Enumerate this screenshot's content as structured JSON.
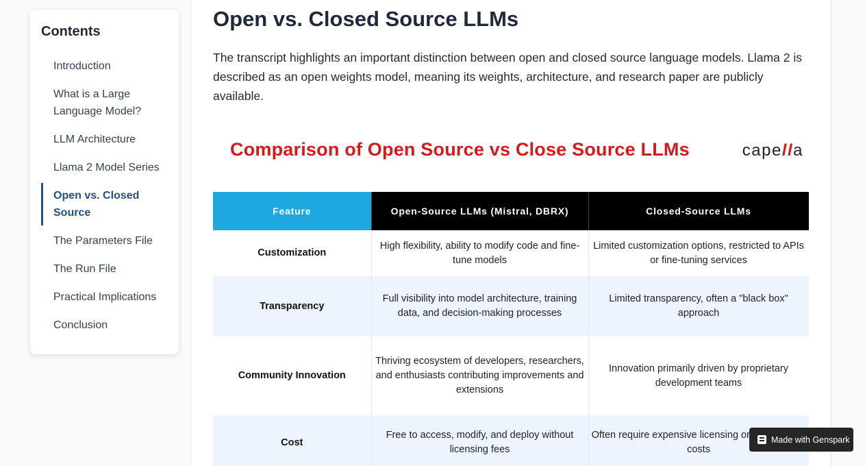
{
  "sidebar": {
    "title": "Contents",
    "items": [
      {
        "label": "Introduction"
      },
      {
        "label": "What is a Large Language Model?"
      },
      {
        "label": "LLM Architecture"
      },
      {
        "label": "Llama 2 Model Series"
      },
      {
        "label": "Open vs. Closed Source",
        "active": true
      },
      {
        "label": "The Parameters File"
      },
      {
        "label": "The Run File"
      },
      {
        "label": "Practical Implications"
      },
      {
        "label": "Conclusion"
      }
    ]
  },
  "main": {
    "heading": "Open vs. Closed Source LLMs",
    "intro": "The transcript highlights an important distinction between open and closed source language models. Llama 2 is described as an open weights model, meaning its weights, architecture, and research paper are publicly available."
  },
  "figure": {
    "title": "Comparison of Open Source vs Close Source LLMs",
    "logo": {
      "prefix": "cape",
      "highlight": "ll",
      "suffix": "a"
    },
    "headers": [
      "Feature",
      "Open-Source LLMs (Mistral, DBRX)",
      "Closed-Source LLMs"
    ],
    "rows": [
      {
        "feature": "Customization",
        "open": "High flexibility, ability to modify code and fine-tune models",
        "closed": "Limited customization options, restricted to APIs or fine-tuning services"
      },
      {
        "feature": "Transparency",
        "open": "Full visibility into model architecture, training data, and decision-making processes",
        "closed": "Limited transparency, often a \"black box\" approach"
      },
      {
        "feature": "Community Innovation",
        "open": "Thriving ecosystem of developers, researchers, and enthusiasts contributing improvements and extensions",
        "closed": "Innovation primarily driven by proprietary development teams"
      },
      {
        "feature": "Cost",
        "open": "Free to access, modify, and deploy without licensing fees",
        "closed": "Often require expensive licensing or subscription costs"
      }
    ],
    "colors": {
      "feature_header": "#1fa8e0",
      "title": "#d41b1b",
      "alt_row": "#eef4fd"
    }
  },
  "badge": {
    "label": "Made with Genspark",
    "icon": "genspark-logo-icon"
  }
}
